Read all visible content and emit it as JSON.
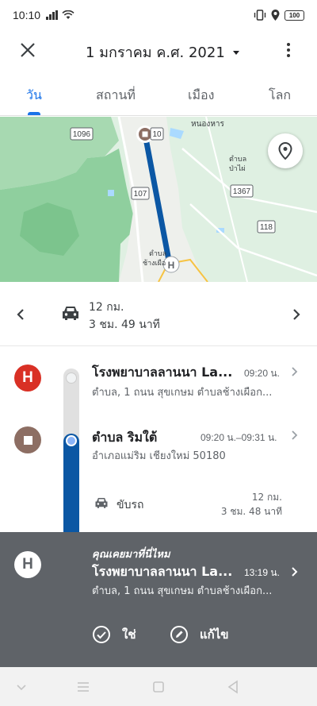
{
  "status_bar": {
    "time": "10:10",
    "battery": "100"
  },
  "app_bar": {
    "date": "1 มกราคม ค.ศ. 2021"
  },
  "tabs": [
    {
      "label": "วัน",
      "active": true
    },
    {
      "label": "สถานที่",
      "active": false
    },
    {
      "label": "เมือง",
      "active": false
    },
    {
      "label": "โลก",
      "active": false
    }
  ],
  "map": {
    "labels": {
      "road_1096": "1096",
      "road_10": "10",
      "road_107": "107",
      "road_1367": "1367",
      "road_118": "118",
      "nong_han": "หนองหาร",
      "tambon_ba_phai_1": "ตำบล",
      "tambon_ba_phai_2": "ป่าไผ่",
      "tambon_chang_1": "ตำบล",
      "tambon_chang_2": "ช้างเผือ"
    },
    "colors": {
      "land": "#dff0e2",
      "forest": "#8fcf9e",
      "route": "#0b57a4"
    }
  },
  "summary": {
    "distance": "12 กม.",
    "duration": "3 ชม. 49 นาที"
  },
  "timeline": {
    "visits": [
      {
        "marker_letter": "H",
        "title": "โรงพยาบาลลานนา La...",
        "time": "09:20 น.",
        "address": "ตำบล, 1 ถนน สุขเกษม ตำบลช้างเผือก..."
      },
      {
        "title": "ตำบล ริมใต้",
        "time": "09:20 น.–09:31 น.",
        "address": "อำเภอแม่ริม เชียงใหม่ 50180"
      }
    ],
    "activity": {
      "label": "ขับรถ",
      "distance": "12 กม.",
      "duration": "3 ชม. 48 นาที"
    }
  },
  "confirmation": {
    "marker_letter": "H",
    "question": "คุณเคยมาที่นี่ไหม",
    "title": "โรงพยาบาลลานนา La...",
    "time": "13:19 น.",
    "address": "ตำบล, 1 ถนน สุขเกษม ตำบลช้างเผือก...",
    "yes_label": "ใช่",
    "edit_label": "แก้ไข"
  },
  "icons": {
    "close": "close-icon",
    "more": "more-vert-icon",
    "location": "place-icon",
    "car": "car-icon",
    "check": "check-circle-icon",
    "edit": "edit-circle-icon"
  }
}
